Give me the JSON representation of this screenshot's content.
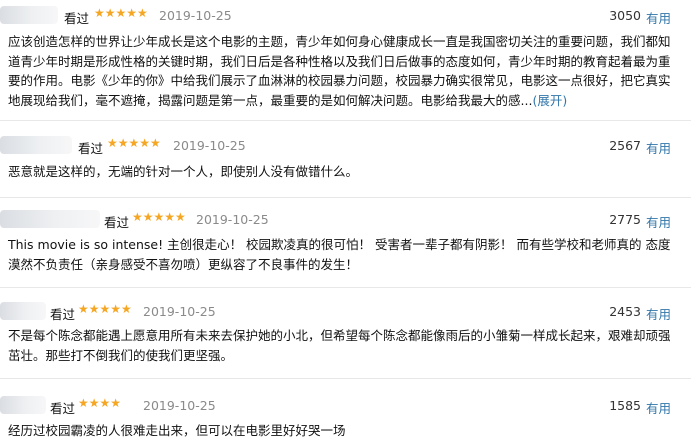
{
  "reviews": [
    {
      "watched": "看过",
      "stars": "★★★★★",
      "date": "2019-10-25",
      "votes": "3050",
      "useful": "有用",
      "text": "应该创造怎样的世界让少年成长是这个电影的主题，青少年如何身心健康成长一直是我国密切关注的重要问题，我们都知道青少年时期是形成性格的关键时期，我们日后是各种性格以及我们日后做事的态度如何，青少年时期的教育起着最为重要的作用。电影《少年的你》中给我们展示了血淋淋的校园暴力问题，校园暴力确实很常见，电影这一点很好，把它真实地展现给我们，毫不遮掩，揭露问题是第一点，最重要的是如何解决问题。电影给我最大的感...",
      "expand": "(展开)"
    },
    {
      "watched": "看过",
      "stars": "★★★★★",
      "date": "2019-10-25",
      "votes": "2567",
      "useful": "有用",
      "text": "恶意就是这样的，无端的针对一个人，即使别人没有做错什么。"
    },
    {
      "watched": "看过",
      "stars": "★★★★★",
      "date": "2019-10-25",
      "votes": "2775",
      "useful": "有用",
      "text": "This movie is so intense! 主创很走心！ 校园欺凌真的很可怕！ 受害者一辈子都有阴影！ 而有些学校和老师真的 态度漠然不负责任（亲身感受不喜勿喷）更纵容了不良事件的发生！"
    },
    {
      "watched": "看过",
      "stars": "★★★★★",
      "date": "2019-10-25",
      "votes": "2453",
      "useful": "有用",
      "text": "不是每个陈念都能遇上愿意用所有未来去保护她的小北，但希望每个陈念都能像雨后的小雏菊一样成长起来，艰难却顽强茁壮。那些打不倒我们的使我们更坚强。"
    },
    {
      "watched": "看过",
      "stars": "★★★★",
      "date": "2019-10-25",
      "votes": "1585",
      "useful": "有用",
      "text": "经历过校园霸凌的人很难走出来，但可以在电影里好好哭一场"
    }
  ]
}
